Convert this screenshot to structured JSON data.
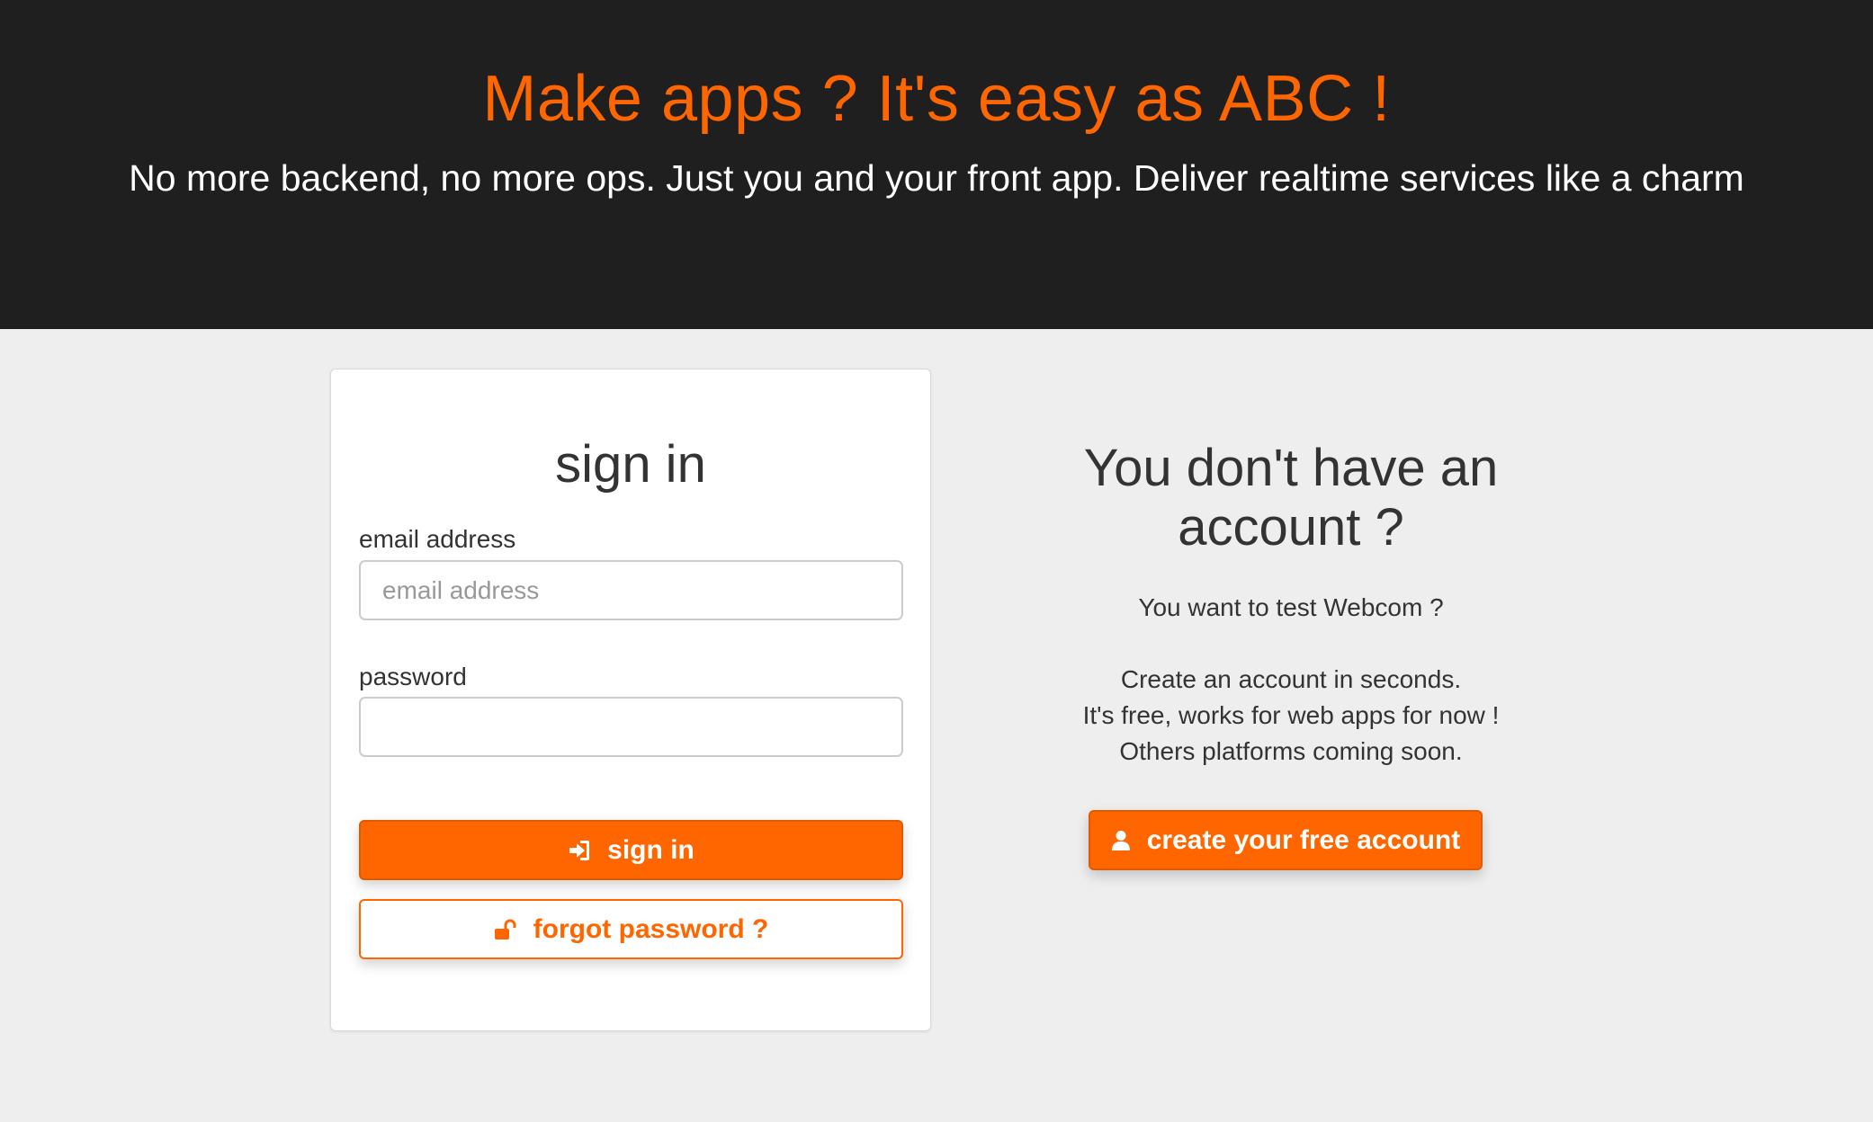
{
  "hero": {
    "title": "Make apps ? It's easy as ABC !",
    "subtitle": "No more backend, no more ops. Just you and your front app. Deliver realtime services like a charm"
  },
  "signin": {
    "title": "sign in",
    "email_label": "email address",
    "email_placeholder": "email address",
    "email_value": "",
    "password_label": "password",
    "password_value": "",
    "submit_label": "sign in",
    "submit_icon": "sign-in-icon",
    "forgot_label": "forgot password ?",
    "forgot_icon": "unlock-icon"
  },
  "signup": {
    "title_line1": "You don't have an",
    "title_line2": "account ?",
    "intro": "You want to test Webcom ?",
    "lines": [
      "Create an account in seconds.",
      "It's free, works for web apps for now !",
      "Others platforms coming soon."
    ],
    "button_label": "create your free account",
    "button_icon": "user-icon"
  },
  "colors": {
    "accent": "#ff6600",
    "hero_background": "#1f1f1f",
    "page_background": "#eeeeee"
  }
}
